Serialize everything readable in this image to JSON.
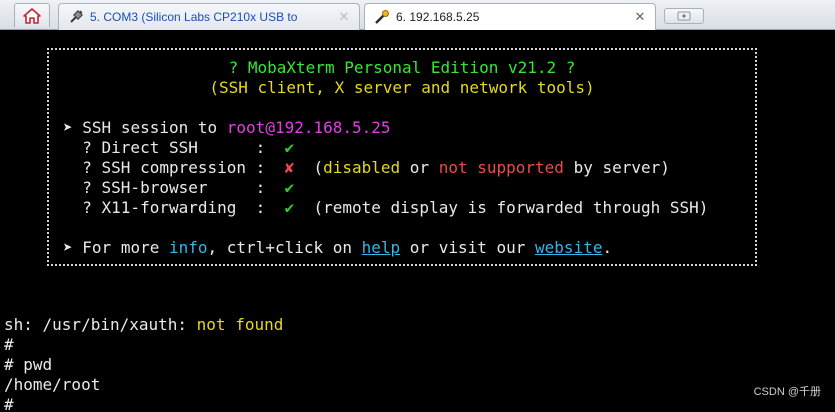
{
  "tabs": {
    "home_icon": "home-icon",
    "items": [
      {
        "label": "5. COM3  (Silicon Labs CP210x USB to",
        "close": "✕",
        "icon": "serial-plug-icon"
      },
      {
        "label": "6. 192.168.5.25",
        "close": "✕",
        "icon": "ssh-key-icon"
      }
    ],
    "new_tab_icon": "new-tab-icon"
  },
  "banner": {
    "title": "? MobaXterm Personal Edition v21.2 ?",
    "subtitle": "(SSH client, X server and network tools)",
    "session": {
      "arrow": "➤",
      "prefix": "SSH session to ",
      "target": "root@192.168.5.25"
    },
    "features": [
      {
        "q": "? ",
        "name": "Direct SSH      ",
        "sep": ":  ",
        "mark": "✔",
        "status": "ok"
      },
      {
        "q": "? ",
        "name": "SSH compression ",
        "sep": ":  ",
        "mark": "✘",
        "status": "fail",
        "note_open": "(",
        "note_disabled": "disabled",
        "note_or": " or ",
        "note_notsupported": "not supported",
        "note_rest": " by server)"
      },
      {
        "q": "? ",
        "name": "SSH-browser     ",
        "sep": ":  ",
        "mark": "✔",
        "status": "ok"
      },
      {
        "q": "? ",
        "name": "X11-forwarding  ",
        "sep": ":  ",
        "mark": "✔",
        "status": "ok",
        "note": "(remote display is forwarded through SSH)"
      }
    ],
    "footer": {
      "arrow": "➤",
      "p1": "For more ",
      "info": "info",
      "p2": ", ctrl+click on ",
      "help": "help",
      "p3": " or visit our ",
      "website": "website",
      "p4": "."
    }
  },
  "shell": {
    "xauth_prefix": "sh: /usr/bin/xauth: ",
    "xauth_status": "not found",
    "lines": [
      "#",
      "# pwd",
      "/home/root",
      "#"
    ]
  },
  "watermark": "CSDN @千册",
  "colors": {
    "background": "#000000",
    "title_green": "#35e835",
    "yellow": "#e6d81b",
    "magenta": "#e63ce6",
    "check_green": "#2bd12b",
    "error_red": "#ef4a4a",
    "link_cyan": "#33b7e8"
  }
}
